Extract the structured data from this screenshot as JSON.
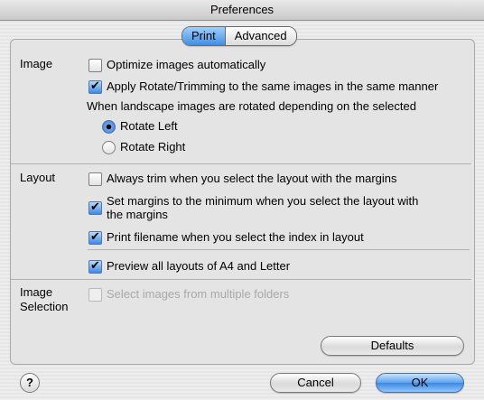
{
  "window": {
    "title": "Preferences"
  },
  "tabs": [
    {
      "label": "Print",
      "selected": true
    },
    {
      "label": "Advanced",
      "selected": false
    }
  ],
  "image": {
    "label": "Image",
    "optimize": {
      "label": "Optimize images automatically",
      "checked": false
    },
    "apply_rotate": {
      "label": "Apply Rotate/Trimming to the same images in the same manner",
      "checked": true
    },
    "landscape_note": "When landscape images are rotated depending on the selected",
    "rotate_left": {
      "label": "Rotate Left",
      "selected": true
    },
    "rotate_right": {
      "label": "Rotate Right",
      "selected": false
    }
  },
  "layout": {
    "label": "Layout",
    "always_trim": {
      "label": "Always trim when you select the layout with the margins",
      "checked": false
    },
    "set_margins": {
      "label": "Set margins to the minimum when you select the layout with the margins",
      "checked": true
    },
    "print_filename": {
      "label": "Print filename when you select the index in layout",
      "checked": true
    },
    "preview_all": {
      "label": "Preview all layouts of A4 and Letter",
      "checked": true
    }
  },
  "image_selection": {
    "label": "Image Selection",
    "multiple_folders": {
      "label": "Select images from multiple folders",
      "checked": false,
      "enabled": false
    }
  },
  "buttons": {
    "defaults": "Defaults",
    "cancel": "Cancel",
    "ok": "OK",
    "help": "?"
  }
}
